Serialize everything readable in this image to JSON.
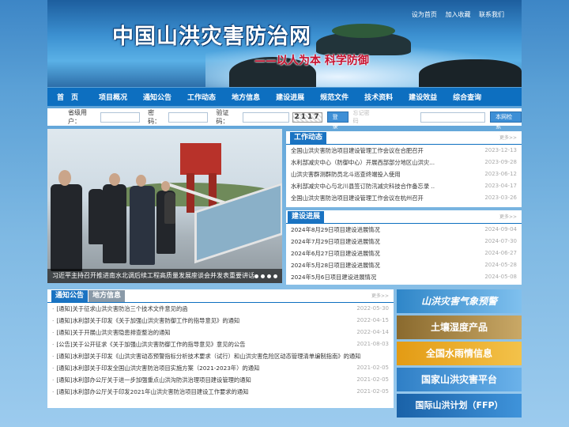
{
  "header": {
    "site_title": "中国山洪灾害防治网",
    "slogan": "——以人为本 科学防御",
    "links": [
      "设为首页",
      "加入收藏",
      "联系我们"
    ]
  },
  "nav": [
    "首　页",
    "项目概况",
    "通知公告",
    "工作动态",
    "地方信息",
    "建设进展",
    "规范文件",
    "技术资料",
    "建设效益",
    "综合查询"
  ],
  "login": {
    "user_label": "省级用户：",
    "password_label": "密码：",
    "captcha_label": "验证码：",
    "captcha_text": "2117",
    "login_button": "登录",
    "forgot": "忘记密码",
    "search_button": "本网检索"
  },
  "photo": {
    "caption": "习近平主持召开推进南水北调后续工程高质量发展座谈会并发表重要讲话"
  },
  "work_news": {
    "title": "工作动态",
    "more": "更多>>",
    "items": [
      {
        "text": "全国山洪灾害防治项目建设管理工作会议在合肥召开",
        "date": "2023-12-13"
      },
      {
        "text": "水利部减灾中心（防御中心）开展西部部分地区山洪灾...",
        "date": "2023-09-28"
      },
      {
        "text": "山洪灾害群测群防员北斗巡查终端投入使用",
        "date": "2023-06-12"
      },
      {
        "text": "水利部减灾中心与北川县签订防汛减灾科技合作备忘录 ..",
        "date": "2023-04-17"
      },
      {
        "text": "全国山洪灾害防治项目建设管理工作会议在杭州召开",
        "date": "2023-03-26"
      }
    ]
  },
  "progress": {
    "title": "建设进展",
    "more": "更多>>",
    "items": [
      {
        "text": "2024年8月29日项目建设进展情况",
        "date": "2024-09-04"
      },
      {
        "text": "2024年7月29日项目建设进展情况",
        "date": "2024-07-30"
      },
      {
        "text": "2024年6月27日项目建设进展情况",
        "date": "2024-06-27"
      },
      {
        "text": "2024年5月28日项目建设进展情况",
        "date": "2024-05-28"
      },
      {
        "text": "2024年5月6日项目建设进展情况",
        "date": "2024-05-08"
      }
    ]
  },
  "notices": {
    "tab_active": "通知公告",
    "tab_inactive": "地方信息",
    "more": "更多>>",
    "items": [
      {
        "text": "[通知]关于征求山洪灾害防治三个技术文件意见的函",
        "date": "2022-05-30"
      },
      {
        "text": "[通知]水利部关于印发《关于加强山洪灾害防御工作的指导意见》的通知",
        "date": "2022-04-15"
      },
      {
        "text": "[通知]关于开展山洪灾害隐患排查整治的通知",
        "date": "2022-04-14"
      },
      {
        "text": "[公告]关于公开征求《关于加强山洪灾害防御工作的指导意见》意见的公告",
        "date": "2021-08-03"
      },
      {
        "text": "[通知]水利部关于印发《山洪灾害动态预警指标分析技术要求（试行）和山洪灾害危险区动态管理清单编制指南》的通知",
        "date": ""
      },
      {
        "text": "[通知]水利部关于印发全国山洪灾害防治项目实施方案（2021-2023年）的通知",
        "date": "2021-02-05"
      },
      {
        "text": "[通知]水利部办公厅关于进一步加强重点山洪沟防洪治理项目建设管理的通知",
        "date": "2021-02-05"
      },
      {
        "text": "[通知]水利部办公厅关于印发2021年山洪灾害防治项目建设工作要求的通知",
        "date": "2021-02-05"
      }
    ]
  },
  "side_banners": [
    {
      "label": "山洪灾害气象预警",
      "color": "#2f86c8"
    },
    {
      "label": "土壤湿度产品",
      "color": "#9b7a3a"
    },
    {
      "label": "全国水雨情信息",
      "color": "#e8a31a"
    },
    {
      "label": "国家山洪灾害平台",
      "color": "#3c8fd2"
    },
    {
      "label": "国际山洪计划（FFP）",
      "color": "#1f6fb8"
    }
  ]
}
